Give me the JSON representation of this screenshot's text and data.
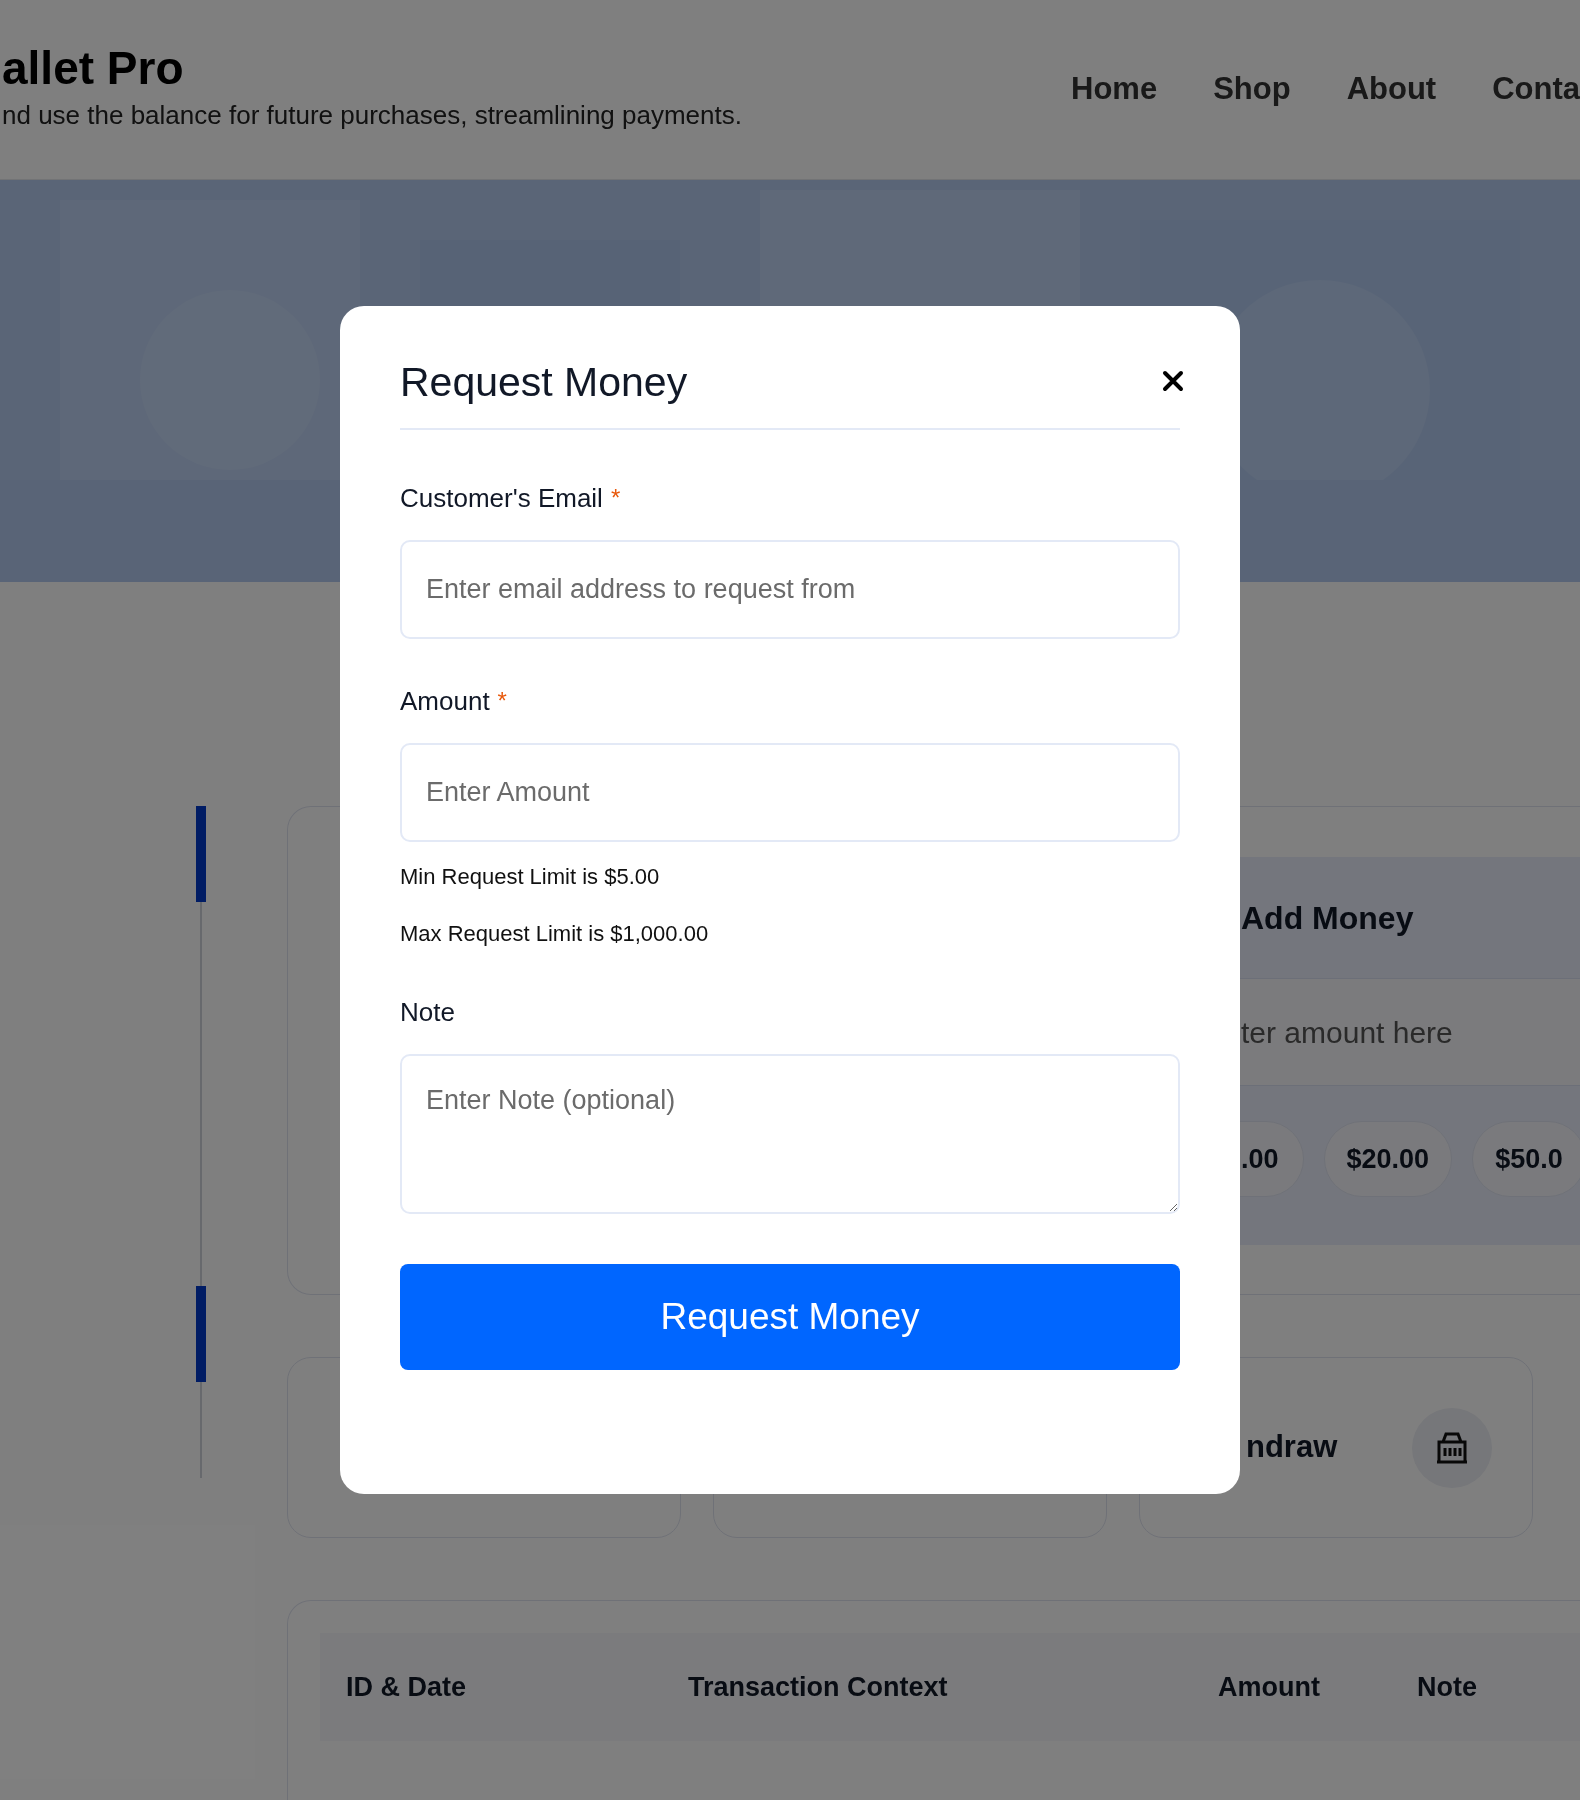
{
  "header": {
    "title": "allet Pro",
    "subtitle": "nd use the balance for future purchases, streamlining payments.",
    "nav": [
      {
        "label": "Home"
      },
      {
        "label": "Shop"
      },
      {
        "label": "About"
      },
      {
        "label": "Conta"
      }
    ]
  },
  "add_money": {
    "title": "Add Money",
    "placeholder": "ter amount here",
    "presets": [
      ".00",
      "$20.00",
      "$50.0"
    ]
  },
  "action_cards": [
    {
      "kind": "blank"
    },
    {
      "kind": "blank"
    },
    {
      "kind": "action",
      "label": "ndraw"
    }
  ],
  "transactions": {
    "columns": [
      "ID & Date",
      "Transaction Context",
      "Amount",
      "Note"
    ]
  },
  "modal": {
    "title": "Request Money",
    "fields": [
      {
        "kind": "input",
        "label": "Customer's Email",
        "required_mark": "*",
        "placeholder": "Enter email address to request from"
      },
      {
        "kind": "input",
        "label": "Amount",
        "required_mark": "*",
        "placeholder": "Enter Amount",
        "hints": [
          "Min Request Limit is $5.00",
          "Max Request Limit is $1,000.00"
        ]
      },
      {
        "kind": "textarea",
        "label": "Note",
        "placeholder": "Enter Note (optional)"
      }
    ],
    "submit": "Request Money"
  }
}
